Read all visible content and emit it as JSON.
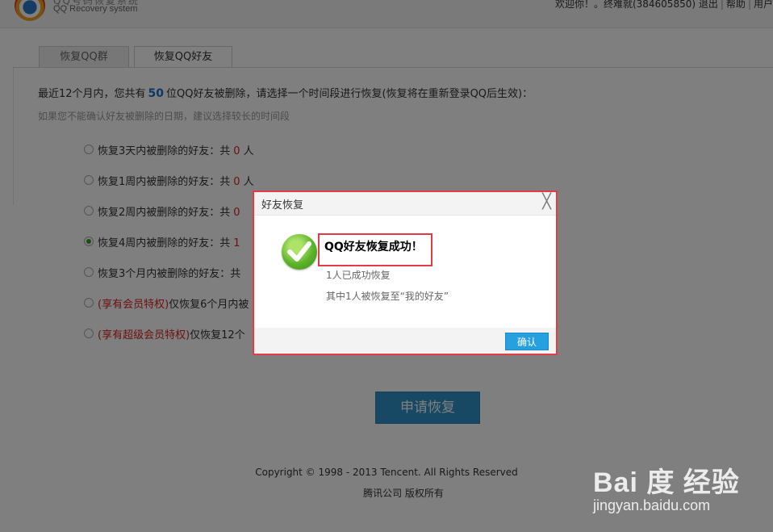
{
  "header": {
    "logo_cn": "QQ号码恢复系统",
    "logo_en": "QQ Recovery system",
    "welcome": "欢迎你！。终难就(384605850)",
    "logout": "退出",
    "help": "帮助",
    "user": "用户"
  },
  "tabs": [
    {
      "label": "恢复QQ群",
      "active": false
    },
    {
      "label": "恢复QQ好友",
      "active": true
    }
  ],
  "intro": {
    "prefix": "最近12个月内，您共有",
    "count": "50",
    "suffix": "位QQ好友被删除，请选择一个时间段进行恢复(恢复将在重新登录QQ后生效)："
  },
  "hint": "如果您不能确认好友被删除的日期，建议选择较长的时间段",
  "options": [
    {
      "pre": "",
      "text": "恢复3天内被删除的好友：共",
      "count": "0",
      "unit": "人",
      "checked": false
    },
    {
      "pre": "",
      "text": "恢复1周内被删除的好友：共",
      "count": "0",
      "unit": "人",
      "checked": false
    },
    {
      "pre": "",
      "text": "恢复2周内被删除的好友：共",
      "count": "0",
      "unit": "",
      "checked": false
    },
    {
      "pre": "",
      "text": "恢复4周内被删除的好友：共",
      "count": "1",
      "unit": "",
      "checked": true
    },
    {
      "pre": "",
      "text": "恢复3个月内被删除的好友：共",
      "count": "",
      "unit": "",
      "checked": false
    },
    {
      "pre": "(享有会员特权)",
      "text": "仅恢复6个月内被",
      "count": "",
      "unit": "",
      "checked": false
    },
    {
      "pre": "(享有超级会员特权)",
      "text": "仅恢复12个",
      "count": "",
      "unit": "",
      "checked": false
    }
  ],
  "apply_button": "申请恢复",
  "footer": {
    "copyright": "Copyright © 1998 - 2013 Tencent. All Rights Reserved",
    "company": "腾讯公司 版权所有"
  },
  "watermark": {
    "logo": "Bai 度 经验",
    "url": "jingyan.baidu.com"
  },
  "dialog": {
    "title": "好友恢复",
    "close": "╳",
    "message_title": "QQ好友恢复成功！",
    "line1": "1人已成功恢复",
    "line2": "其中1人被恢复至“我的好友”",
    "confirm": "确认"
  },
  "colors": {
    "accent_blue": "#1a6fc9",
    "highlight_red": "#e53b45",
    "button_blue": "#27a0df",
    "success_green": "#5db42a"
  }
}
